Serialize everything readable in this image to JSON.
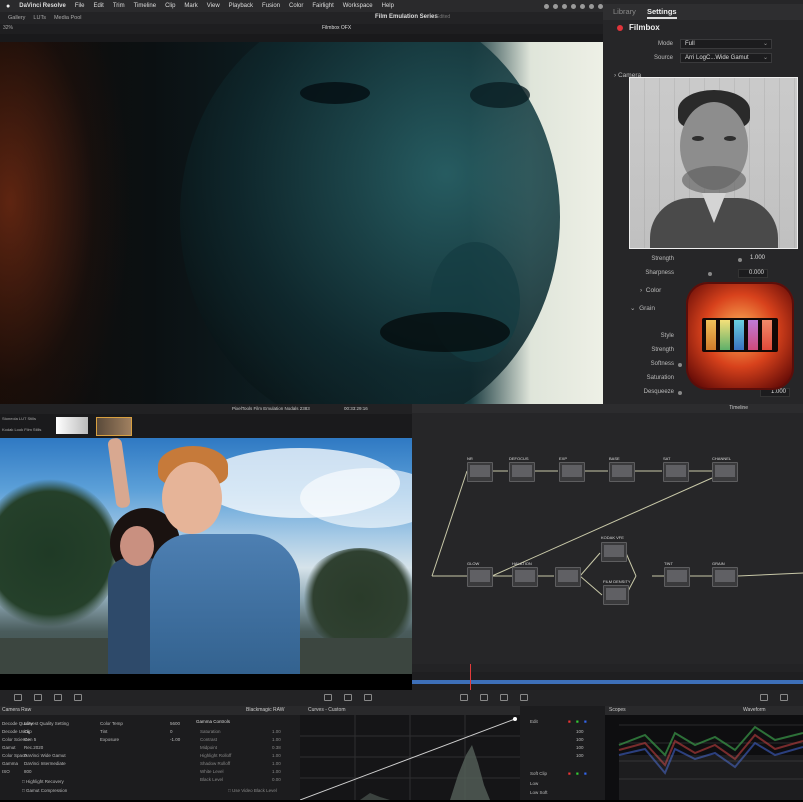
{
  "menubar": {
    "apple": "",
    "items": [
      "DaVinci Resolve",
      "File",
      "Edit",
      "Trim",
      "Timeline",
      "Clip",
      "Mark",
      "View",
      "Playback",
      "Fusion",
      "Color",
      "Fairlight",
      "Workspace",
      "Help"
    ]
  },
  "toolbar_top": {
    "gallery": "Gallery",
    "luts": "LUTs",
    "media_pool": "Media Pool"
  },
  "project": {
    "title": "Film Emulation Series",
    "status": "Edited"
  },
  "viewer": {
    "zoom": "32%",
    "node_name": "Filmbox OFX"
  },
  "panel": {
    "tabs": [
      "Library",
      "Settings"
    ],
    "active_tab": "Settings",
    "plugin_name": "Filmbox",
    "mode_label": "Mode",
    "mode_value": "Full",
    "source_label": "Source",
    "source_value": "Arri LogC...Wide Gamut",
    "sections": {
      "camera": "Camera",
      "color": "Color",
      "grain": "Grain"
    },
    "rows": [
      {
        "label": "Strength",
        "value": "1.000"
      },
      {
        "label": "Sharpness",
        "value": "0.000"
      }
    ],
    "grain_rows": [
      {
        "label": "Style"
      },
      {
        "label": "Strength"
      },
      {
        "label": "Softness"
      },
      {
        "label": "Saturation"
      },
      {
        "label": "Desqueeze",
        "value": "1.000"
      }
    ]
  },
  "lower": {
    "lut_browser": "Stoneola LUT Stills",
    "lut_item": "Kodak Look Film Stills",
    "viewer_header": "PixelTools Film Emulation Nodals 2383",
    "timecode": "00:33:29:16",
    "timeline_label": "Timeline",
    "nodes": [
      "NR",
      "DEFOCUS",
      "EXP",
      "BASE",
      "SAT",
      "CHANNEL",
      "GLOW",
      "HALATION",
      "KODAK VFE",
      "FILM DENSITY",
      "TINT",
      "GRAIN"
    ],
    "camera_raw": "Camera Raw",
    "blackmagic_raw": "Blackmagic RAW",
    "curves": "Curves - Custom",
    "scopes": "Scopes",
    "waveform": "Waveform",
    "raw_rows": [
      "Decode Quality",
      "Decode Using",
      "Color Science",
      "Gamut",
      "Color Space",
      "Gamma",
      "ISO"
    ],
    "raw_values": [
      "Lowest Quality Setting",
      "Clip",
      "Gen 5",
      "Rec.2020",
      "DaVinci Wide Gamut",
      "DaVinci Intermediate",
      "800"
    ],
    "raw_checks": [
      "Highlight Recovery",
      "Gamut Compression"
    ],
    "color_rows": [
      "Color Temp",
      "Tint",
      "Exposure"
    ],
    "color_values": [
      "5600",
      "0",
      "-1.00"
    ],
    "gamma_title": "Gamma Controls",
    "gamma_rows": [
      "Saturation",
      "Contrast",
      "Midpoint",
      "Highlight Rolloff",
      "Shadow Rolloff",
      "White Level",
      "Black Level"
    ],
    "gamma_values": [
      "1.00",
      "1.00",
      "0.38",
      "1.00",
      "1.00",
      "1.00",
      "0.00"
    ],
    "gamma_check": "Use Video Black Level",
    "edit_label": "Edit",
    "softclip_label": "Soft Clip",
    "softclip_rows": [
      "Low",
      "Low Soft"
    ],
    "edit_values": [
      "100",
      "100",
      "100",
      "100"
    ]
  }
}
